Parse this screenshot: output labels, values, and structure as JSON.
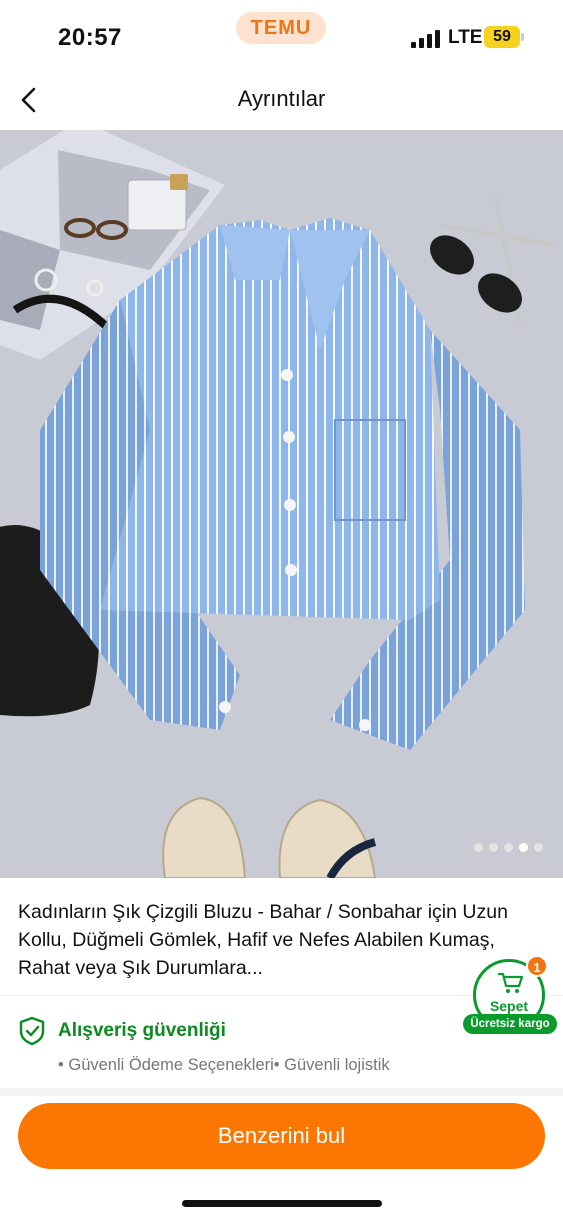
{
  "status_bar": {
    "time": "20:57",
    "app_badge": "TEMU",
    "network": "LTE",
    "battery": "59",
    "icons": [
      "signal-icon",
      "battery-icon"
    ]
  },
  "header": {
    "title": "Ayrıntılar",
    "back_icon": "chevron-left-icon"
  },
  "gallery": {
    "image_count": 5,
    "active_index": 3
  },
  "product": {
    "title": "Kadınların Şık Çizgili Bluzu - Bahar / Sonbahar için Uzun Kollu, Düğmeli Gömlek, Hafif ve Nefes Alabilen Kumaş, Rahat veya Şık Durumlara..."
  },
  "security": {
    "title": "Alışveriş güvenliği",
    "items": "• Güvenli Ödeme Seçenekleri• Güvenli lojistik",
    "icon": "shield-check-icon"
  },
  "cart": {
    "label": "Sepet",
    "badge": "1",
    "free_shipping": "Ücretsiz kargo",
    "icon": "cart-icon"
  },
  "cta": {
    "label": "Benzerini bul"
  },
  "colors": {
    "accent": "#fb7701",
    "success": "#0b9b2d",
    "temu_orange": "#f27314"
  }
}
